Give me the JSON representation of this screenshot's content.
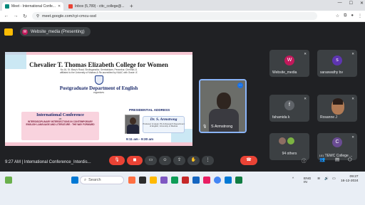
{
  "browser": {
    "tabs": [
      {
        "label": "Meet - International Confe...",
        "icon": "meet-favicon",
        "active": true
      },
      {
        "label": "Inbox (5,789) - cttc_college@...",
        "icon": "gmail-favicon",
        "active": false
      }
    ],
    "new_tab": "+",
    "url": "meet.google.com/cyi-cmcu-ssd"
  },
  "meet": {
    "presenting_avatar": "W",
    "presenting_label": "Website_media (Presenting)"
  },
  "slide": {
    "college": "Chevalier T. Thomas Elizabeth College for Women",
    "address_line1": "No.16, St. Mary's Road, Sholinganallur, Sembakkam, Perambur, Chennai-11",
    "address_line2": "affiliated to the University of Madras & Re-accredited by NAAC with Grade 'A'",
    "department": "Postgraduate Department of English",
    "organises": "organises",
    "conference_title": "International Conference",
    "conference_on": "on",
    "conference_theme": "INTERDISCIPLINARY INTERSECTIONS IN CONTEMPORARY ENGLISH LANGUAGE AND LITERATURE : THE WAY FORWARD",
    "presidential": "PRESIDENTIAL ADDRESS",
    "speaker_name": "Dr. S. Armstrong",
    "speaker_role": "Professor & Head, PG & Research Department of English, University of Madras",
    "time": "9:11 am - 9:30 am"
  },
  "participants": {
    "main_speaker": "S Armstrong",
    "grid": [
      {
        "name": "Website_media",
        "initial": "W",
        "color": "#c2185b"
      },
      {
        "name": "saraswathy bv",
        "initial": "s",
        "color": "#5e35b1"
      },
      {
        "name": "fahamida k",
        "initial": "f",
        "color": "#5f6368"
      },
      {
        "name": "Rosanne J",
        "initial": "",
        "color": "#3c4043"
      },
      {
        "name": "94 others",
        "initial": "",
        "color": "#3c4043"
      },
      {
        "name": "CTTEWC College ...",
        "initial": "C",
        "color": "#6a4c93"
      }
    ]
  },
  "bottom_bar": {
    "time": "9:27 AM",
    "separator": "|",
    "meeting_title": "International Conference_Interdis...",
    "participant_count": "101"
  },
  "taskbar": {
    "search_placeholder": "Search",
    "lang": "ENG",
    "region": "IN",
    "clock_time": "09:27",
    "clock_date": "16-12-2024"
  }
}
